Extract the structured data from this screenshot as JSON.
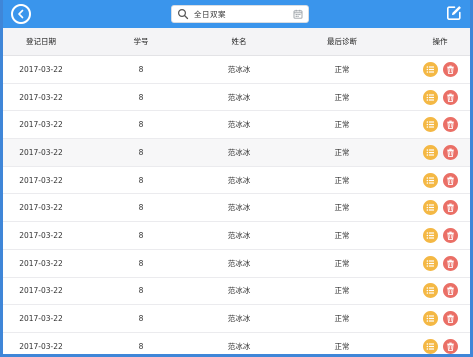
{
  "topbar": {
    "search_text": "全日双案"
  },
  "table": {
    "headers": {
      "date": "登记日期",
      "id": "学号",
      "name": "姓名",
      "diagnosis": "最后诊断",
      "actions": "操作"
    },
    "rows": [
      {
        "date": "2017-03-22",
        "id": "8",
        "name": "范冰冰",
        "diagnosis": "正常"
      },
      {
        "date": "2017-03-22",
        "id": "8",
        "name": "范冰冰",
        "diagnosis": "正常"
      },
      {
        "date": "2017-03-22",
        "id": "8",
        "name": "范冰冰",
        "diagnosis": "正常"
      },
      {
        "date": "2017-03-22",
        "id": "8",
        "name": "范冰冰",
        "diagnosis": "正常"
      },
      {
        "date": "2017-03-22",
        "id": "8",
        "name": "范冰冰",
        "diagnosis": "正常"
      },
      {
        "date": "2017-03-22",
        "id": "8",
        "name": "范冰冰",
        "diagnosis": "正常"
      },
      {
        "date": "2017-03-22",
        "id": "8",
        "name": "范冰冰",
        "diagnosis": "正常"
      },
      {
        "date": "2017-03-22",
        "id": "8",
        "name": "范冰冰",
        "diagnosis": "正常"
      },
      {
        "date": "2017-03-22",
        "id": "8",
        "name": "范冰冰",
        "diagnosis": "正常"
      },
      {
        "date": "2017-03-22",
        "id": "8",
        "name": "范冰冰",
        "diagnosis": "正常"
      },
      {
        "date": "2017-03-22",
        "id": "8",
        "name": "范冰冰",
        "diagnosis": "正常"
      }
    ]
  },
  "icons": {
    "back": "back-arrow-icon",
    "search": "search-icon",
    "calendar": "calendar-icon",
    "edit": "edit-icon",
    "detail": "list-icon",
    "delete": "trash-icon"
  },
  "colors": {
    "topbar": "#3a95ec",
    "detail_button": "#f4b844",
    "delete_button": "#ea6f66"
  }
}
